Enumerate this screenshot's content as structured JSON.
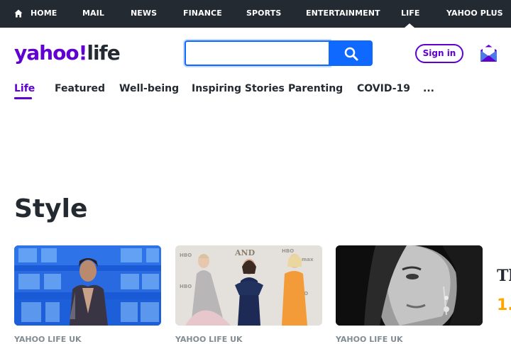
{
  "topnav": {
    "items": [
      {
        "label": "HOME"
      },
      {
        "label": "MAIL"
      },
      {
        "label": "NEWS"
      },
      {
        "label": "FINANCE"
      },
      {
        "label": "SPORTS"
      },
      {
        "label": "ENTERTAINMENT"
      },
      {
        "label": "LIFE"
      },
      {
        "label": "YAHOO PLUS"
      }
    ],
    "active": "LIFE"
  },
  "header": {
    "logo_yahoo": "yahoo",
    "logo_bang": "!",
    "logo_life": "life",
    "search_value": "",
    "search_icon": "magnifier-icon",
    "signin_label": "Sign in",
    "mail_icon": "envelope-icon"
  },
  "subnav": {
    "items": [
      {
        "label": "Life"
      },
      {
        "label": "Featured"
      },
      {
        "label": "Well-being"
      },
      {
        "label": "Inspiring Stories"
      },
      {
        "label": "Parenting"
      },
      {
        "label": "COVID-19"
      },
      {
        "label": "..."
      }
    ],
    "active": "Life"
  },
  "main": {
    "title": "Style",
    "cards": [
      {
        "source": "YAHOO LIFE UK"
      },
      {
        "source": "YAHOO LIFE UK"
      },
      {
        "source": "YAHOO LIFE UK"
      }
    ],
    "side_partial_heading": "Th",
    "side_partial_number": "1."
  },
  "colors": {
    "brand_purple": "#6001d2",
    "nav_dark": "#232a31",
    "search_blue": "#0f69ff",
    "accent_yellow": "#ffa700"
  }
}
